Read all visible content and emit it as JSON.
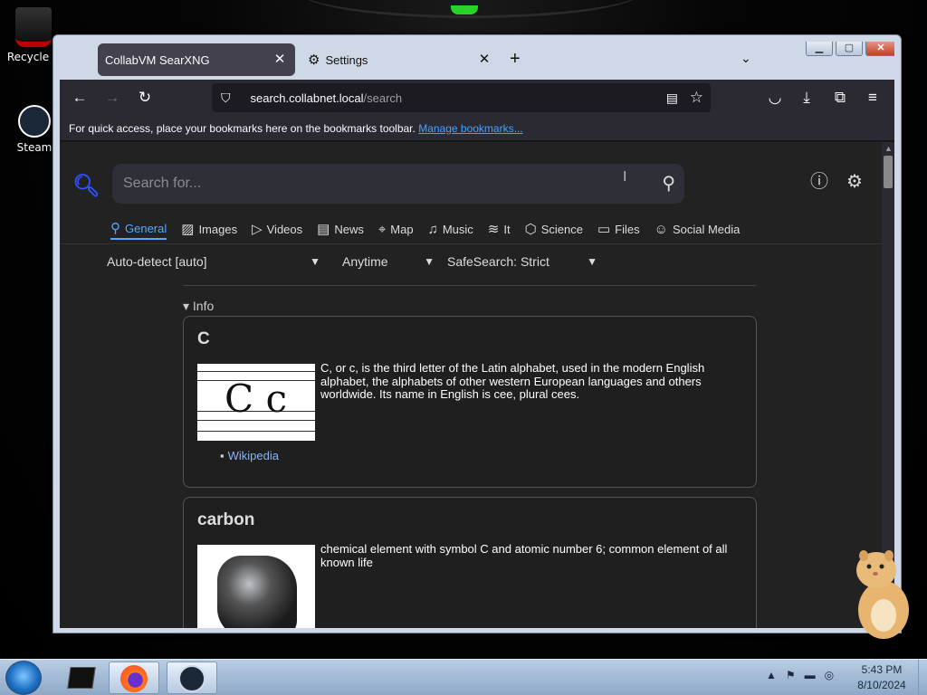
{
  "desktop": {
    "icons": [
      {
        "label": "Recycle B"
      },
      {
        "label": "Steam"
      }
    ]
  },
  "browser": {
    "tabs": [
      {
        "label": "CollabVM SearXNG",
        "active": true
      },
      {
        "label": "Settings",
        "active": false
      }
    ],
    "url_host": "search.collabnet.local",
    "url_path": "/search",
    "bookmarks_text": "For quick access, place your bookmarks here on the bookmarks toolbar.",
    "bookmarks_link": "Manage bookmarks..."
  },
  "search": {
    "placeholder": "Search for...",
    "categories": [
      {
        "label": "General",
        "icon": "search-icon",
        "active": true
      },
      {
        "label": "Images",
        "icon": "image-icon"
      },
      {
        "label": "Videos",
        "icon": "play-icon"
      },
      {
        "label": "News",
        "icon": "newspaper-icon"
      },
      {
        "label": "Map",
        "icon": "map-pin-icon"
      },
      {
        "label": "Music",
        "icon": "music-icon"
      },
      {
        "label": "It",
        "icon": "layers-icon"
      },
      {
        "label": "Science",
        "icon": "cube-icon"
      },
      {
        "label": "Files",
        "icon": "files-icon"
      },
      {
        "label": "Social Media",
        "icon": "people-icon"
      }
    ],
    "filters": {
      "language": "Auto-detect [auto]",
      "time": "Anytime",
      "safesearch": "SafeSearch: Strict"
    }
  },
  "infobox": {
    "header": "Info",
    "cards": [
      {
        "title": "C",
        "description": "C, or c, is the third letter of the Latin alphabet, used in the modern English alphabet, the alphabets of other western European languages and others worldwide. Its name in English is cee, plural cees.",
        "image_text": "C c",
        "link": "Wikipedia"
      },
      {
        "title": "carbon",
        "description": "chemical element with symbol C and atomic number 6; common element of all known life"
      }
    ]
  },
  "taskbar": {
    "time": "5:43 PM",
    "date": "8/10/2024"
  },
  "colors": {
    "accent": "#58a6ff",
    "page_bg": "#222222",
    "logo": "#3050ff"
  }
}
